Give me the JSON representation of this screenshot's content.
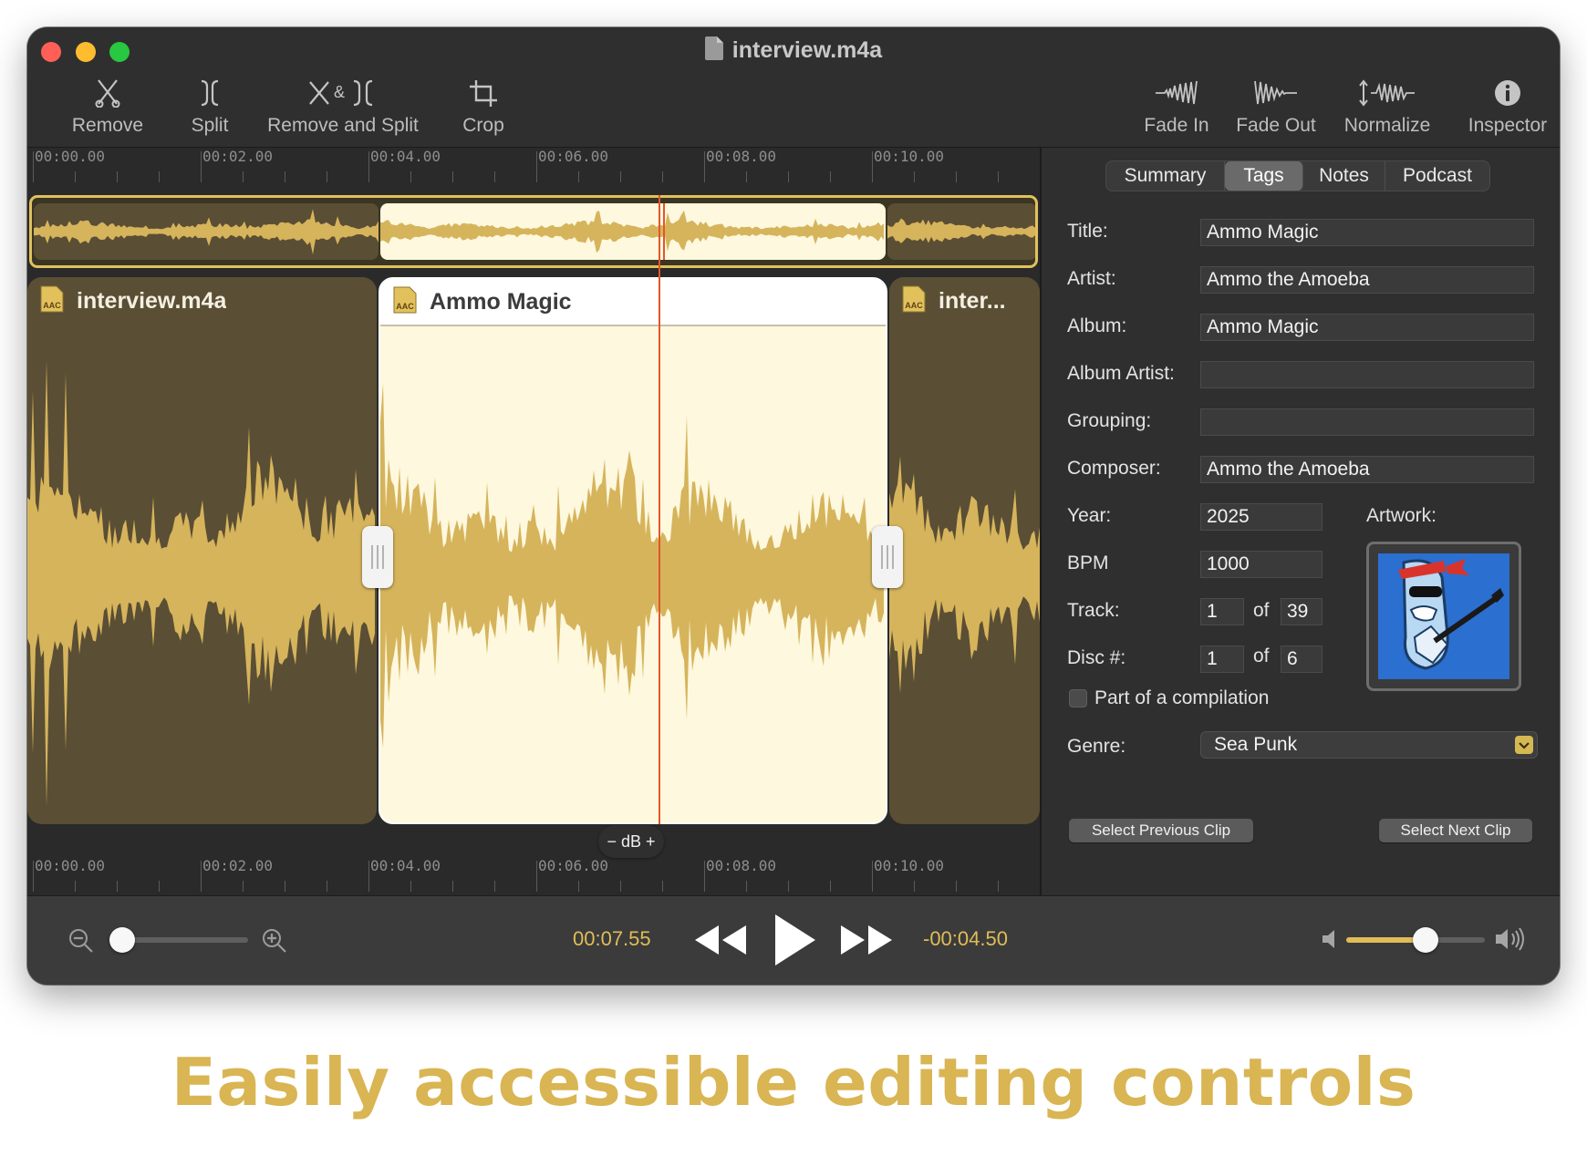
{
  "window": {
    "title": "interview.m4a"
  },
  "toolbar": {
    "remove": "Remove",
    "split": "Split",
    "remove_and_split": "Remove and Split",
    "crop": "Crop",
    "fade_in": "Fade In",
    "fade_out": "Fade Out",
    "normalize": "Normalize",
    "inspector": "Inspector"
  },
  "ruler": {
    "ticks": [
      "00:00.00",
      "00:02.00",
      "00:04.00",
      "00:06.00",
      "00:08.00",
      "00:10.00"
    ]
  },
  "clips": [
    {
      "name": "interview.m4a",
      "format": "AAC",
      "selected": false
    },
    {
      "name": "Ammo Magic",
      "format": "AAC",
      "selected": true
    },
    {
      "name": "inter...",
      "format": "AAC",
      "selected": false
    }
  ],
  "gain_control": {
    "label": "− dB +"
  },
  "inspector": {
    "tabs": [
      "Summary",
      "Tags",
      "Notes",
      "Podcast"
    ],
    "active_tab": "Tags",
    "labels": {
      "title": "Title:",
      "artist": "Artist:",
      "album": "Album:",
      "album_artist": "Album Artist:",
      "grouping": "Grouping:",
      "composer": "Composer:",
      "year": "Year:",
      "bpm": "BPM",
      "track": "Track:",
      "disc": "Disc #:",
      "of": "of",
      "artwork": "Artwork:",
      "compilation": "Part of a compilation",
      "genre": "Genre:"
    },
    "values": {
      "title": "Ammo Magic",
      "artist": "Ammo the Amoeba",
      "album": "Ammo Magic",
      "album_artist": "",
      "grouping": "",
      "composer": "Ammo the Amoeba",
      "year": "2025",
      "bpm": "1000",
      "track": "1",
      "track_total": "39",
      "disc": "1",
      "disc_total": "6",
      "compilation": false,
      "genre": "Sea Punk"
    },
    "select_previous": "Select Previous Clip",
    "select_next": "Select Next Clip"
  },
  "transport": {
    "current_time": "00:07.55",
    "remaining_time": "-00:04.50",
    "zoom_level": 0,
    "volume_level": 0.57
  },
  "colors": {
    "accent": "#e0bd57",
    "playhead": "#e2572a",
    "waveform": "#d6b45c"
  },
  "caption": "Easily accessible editing controls"
}
